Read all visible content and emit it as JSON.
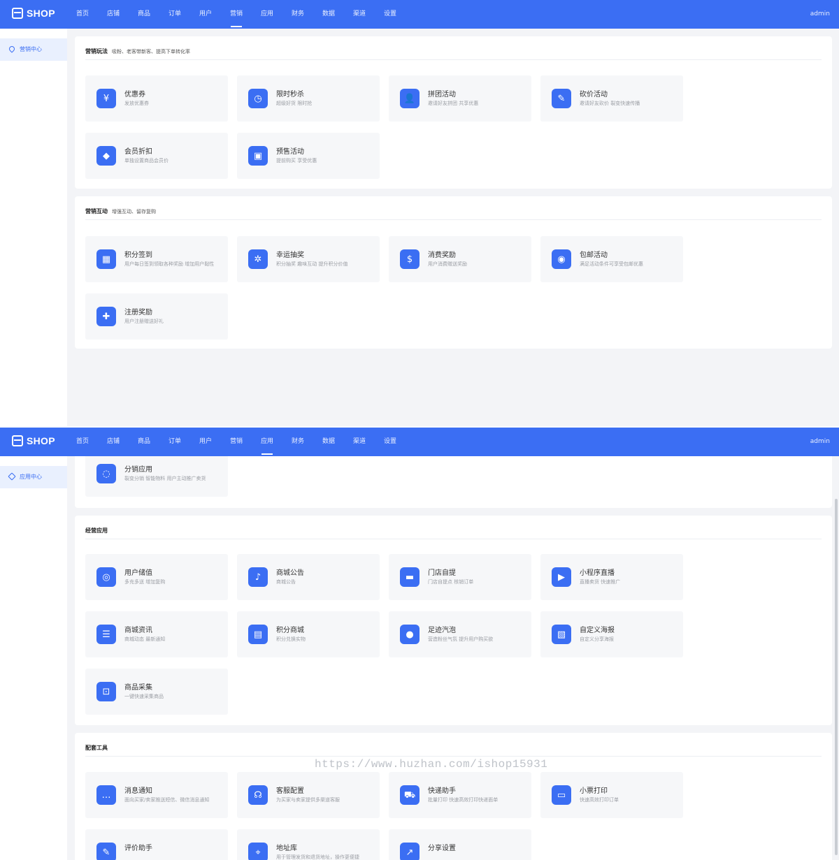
{
  "brand": {
    "name": "SHOP"
  },
  "nav": [
    "首页",
    "店铺",
    "商品",
    "订单",
    "用户",
    "营销",
    "应用",
    "财务",
    "数据",
    "渠道",
    "设置"
  ],
  "user": "admin",
  "shot1": {
    "sidebar_label": "营销中心",
    "sections": [
      {
        "title": "营销玩法",
        "subtitle": "吸粉、老客带新客、提高下单转化率",
        "cards": [
          {
            "title": "优惠券",
            "desc": "发放优惠券",
            "icon": "coupon-icon",
            "glyph": "¥"
          },
          {
            "title": "限时秒杀",
            "desc": "超级好货 限时抢",
            "icon": "clock-icon",
            "glyph": "◷"
          },
          {
            "title": "拼团活动",
            "desc": "邀请好友拼团 共享优惠",
            "icon": "group-icon",
            "glyph": "👤"
          },
          {
            "title": "砍价活动",
            "desc": "邀请好友砍价 裂变快速传播",
            "icon": "tag-icon",
            "glyph": "✎"
          },
          {
            "title": "会员折扣",
            "desc": "单独设置商品会员价",
            "icon": "diamond-icon",
            "glyph": "◆"
          },
          {
            "title": "预售活动",
            "desc": "提前购买 享受优惠",
            "icon": "presale-bag-icon",
            "glyph": "▣"
          }
        ]
      },
      {
        "title": "营销互动",
        "subtitle": "增强互动、留存复购",
        "cards": [
          {
            "title": "积分签到",
            "desc": "用户每日签到领取各种奖励 增加用户黏性",
            "icon": "calendar-icon",
            "glyph": "▦"
          },
          {
            "title": "幸运抽奖",
            "desc": "积分抽奖 趣味互动 提升积分价值",
            "icon": "wheel-icon",
            "glyph": "✲"
          },
          {
            "title": "消费奖励",
            "desc": "用户消费赠送奖励",
            "icon": "money-bag-icon",
            "glyph": "$"
          },
          {
            "title": "包邮活动",
            "desc": "满足活动条件可享受包邮优惠",
            "icon": "shipping-icon",
            "glyph": "◉"
          },
          {
            "title": "注册奖励",
            "desc": "用户注册赠送好礼",
            "icon": "gift-icon",
            "glyph": "✚"
          }
        ]
      }
    ]
  },
  "shot2": {
    "sidebar_label": "应用中心",
    "top_card": {
      "title": "分销应用",
      "desc": "裂变分销 智能物料 用户主动推广卖货",
      "icon": "share-network-icon",
      "glyph": "◌"
    },
    "sections": [
      {
        "title": "经营应用",
        "subtitle": "",
        "cards": [
          {
            "title": "用户储值",
            "desc": "多充多送 增加复购",
            "icon": "stored-value-icon",
            "glyph": "◎"
          },
          {
            "title": "商城公告",
            "desc": "商城公告",
            "icon": "bell-icon",
            "glyph": "♪"
          },
          {
            "title": "门店自提",
            "desc": "门店自提点 核销订单",
            "icon": "store-icon",
            "glyph": "▬"
          },
          {
            "title": "小程序直播",
            "desc": "直播卖货 快速推广",
            "icon": "play-icon",
            "glyph": "▶"
          },
          {
            "title": "商城资讯",
            "desc": "商城动态 最新通知",
            "icon": "news-icon",
            "glyph": "☰"
          },
          {
            "title": "积分商城",
            "desc": "积分兑换实物",
            "icon": "points-mall-icon",
            "glyph": "▤"
          },
          {
            "title": "足迹汽泡",
            "desc": "营造粉丝气氛 提升用户购买欲",
            "icon": "bubble-icon",
            "glyph": "●"
          },
          {
            "title": "自定义海报",
            "desc": "自定义分享海报",
            "icon": "image-icon",
            "glyph": "▧"
          },
          {
            "title": "商品采集",
            "desc": "一键快速采集商品",
            "icon": "collect-icon",
            "glyph": "⊡"
          }
        ]
      },
      {
        "title": "配套工具",
        "subtitle": "",
        "cards": [
          {
            "title": "消息通知",
            "desc": "面向买家/卖家推送短信、微信消息通知",
            "icon": "message-icon",
            "glyph": "…"
          },
          {
            "title": "客服配置",
            "desc": "为买家与卖家提供多渠道客服",
            "icon": "headset-icon",
            "glyph": "☊"
          },
          {
            "title": "快递助手",
            "desc": "批量打印 快速高效打印快递面单",
            "icon": "truck-icon",
            "glyph": "⛟"
          },
          {
            "title": "小票打印",
            "desc": "快速高效打印订单",
            "icon": "printer-icon",
            "glyph": "▭"
          },
          {
            "title": "评价助手",
            "desc": "",
            "icon": "review-icon",
            "glyph": "✎"
          },
          {
            "title": "地址库",
            "desc": "用于管理发货和退货地址，操作更便捷",
            "icon": "location-icon",
            "glyph": "⌖"
          },
          {
            "title": "分享设置",
            "desc": "",
            "icon": "share-icon",
            "glyph": "↗"
          }
        ]
      }
    ]
  },
  "watermark": "https://www.huzhan.com/ishop15931"
}
